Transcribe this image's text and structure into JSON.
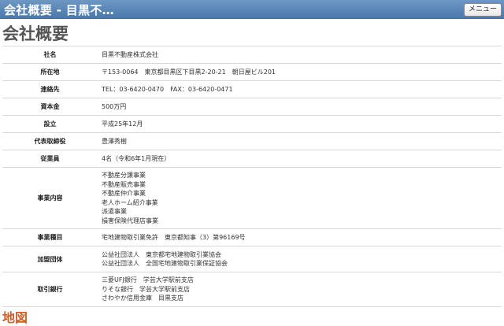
{
  "header": {
    "title": "会社概要 - 目黒不…",
    "menu_label": "メニュー"
  },
  "page_title": "会社概要",
  "rows": [
    {
      "label": "社名",
      "lines": [
        "目黒不動産株式会社"
      ]
    },
    {
      "label": "所在地",
      "lines": [
        "〒153-0064　東京都目黒区下目黒2-20-21　朝日屋ビル201"
      ]
    },
    {
      "label": "連絡先",
      "lines": [
        "TEL：03-6420-0470　FAX：03-6420-0471"
      ]
    },
    {
      "label": "資本金",
      "lines": [
        "500万円"
      ]
    },
    {
      "label": "設立",
      "lines": [
        "平成25年12月"
      ]
    },
    {
      "label": "代表取締役",
      "lines": [
        "豊澤秀樹"
      ]
    },
    {
      "label": "従業員",
      "lines": [
        "4名（令和6年1月現在）"
      ]
    },
    {
      "label": "事業内容",
      "lines": [
        "不動産分譲事業",
        "不動産販売事業",
        "不動産仲介事業",
        "老人ホーム紹介事業",
        "派遣事業",
        "損害保険代理店事業"
      ]
    },
    {
      "label": "事業種目",
      "lines": [
        "宅地建物取引業免許　東京都知事（3）第96169号"
      ]
    },
    {
      "label": "加盟団体",
      "lines": [
        "公益社団法人　東京都宅地建物取引業協会",
        "公益社団法人　全国宅地建物取引業保証協会"
      ]
    },
    {
      "label": "取引銀行",
      "lines": [
        "三菱UFJ銀行　学芸大学駅前支店",
        "りそな銀行　学芸大学駅前支店",
        "さわやか信用金庫　目黒支店"
      ]
    }
  ],
  "map_title": "地図"
}
